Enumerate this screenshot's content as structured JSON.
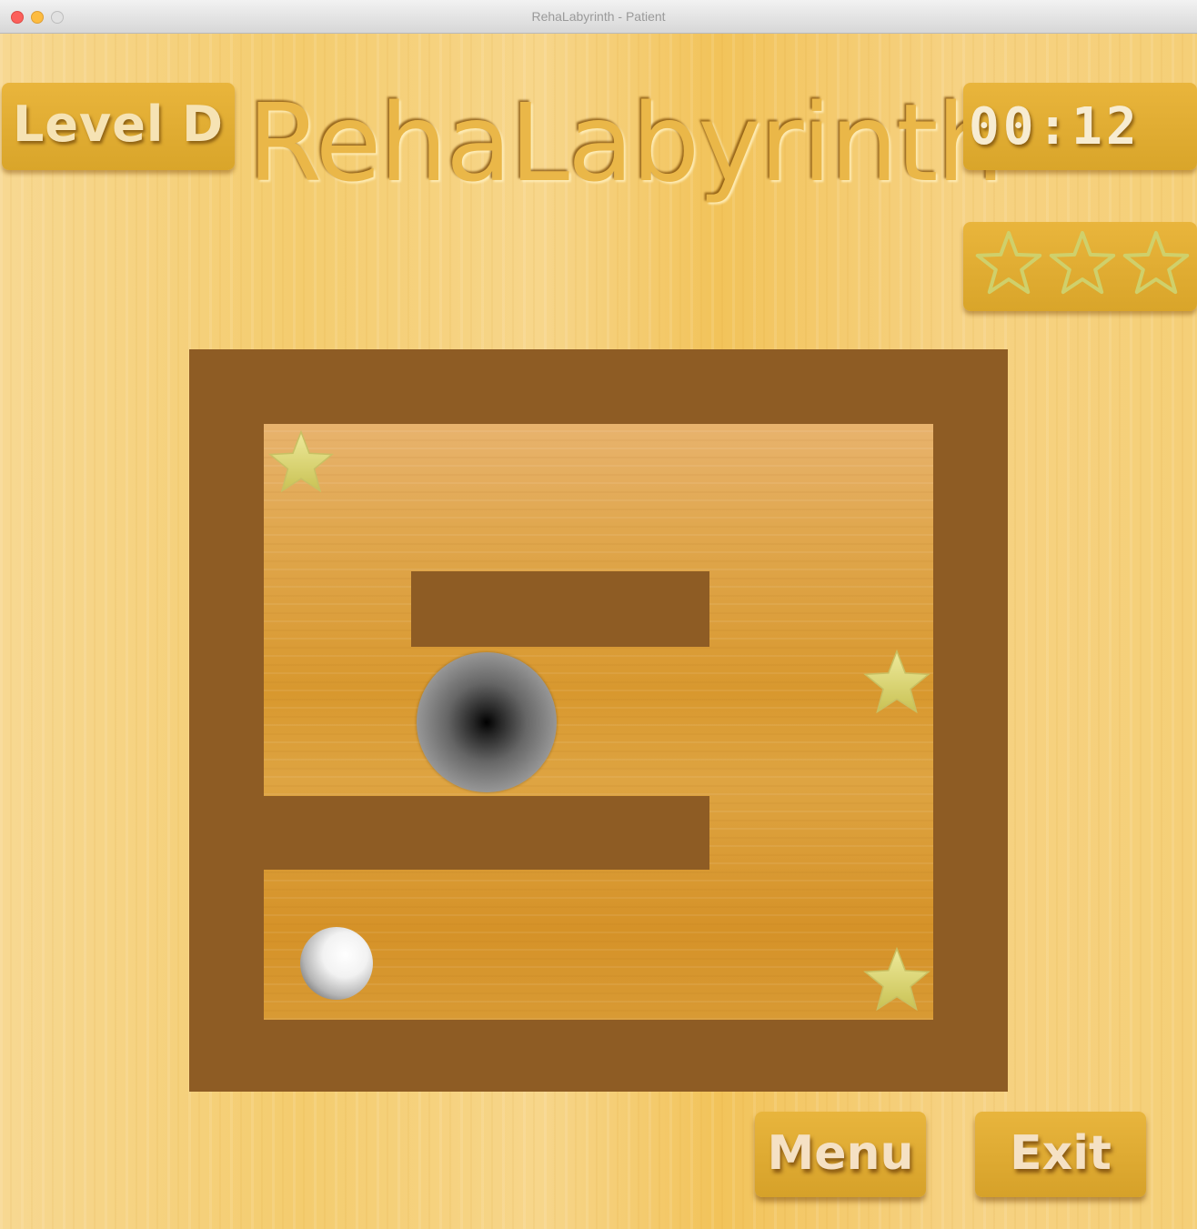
{
  "window": {
    "title": "RehaLabyrinth - Patient"
  },
  "header": {
    "level_label": "Level D",
    "app_title": "RehaLabyrinth",
    "timer": "00:12",
    "stars_collected": 0,
    "stars_total": 3
  },
  "board": {
    "stars_remaining": 3,
    "ball_color": "#ffffff",
    "hole_color": "#000000",
    "wall_color": "#8e5c24"
  },
  "buttons": {
    "menu_label": "Menu",
    "exit_label": "Exit"
  },
  "colors": {
    "panel": "#e2ae35",
    "background": "#f5cf77",
    "star_gold": "#e3de7e"
  }
}
